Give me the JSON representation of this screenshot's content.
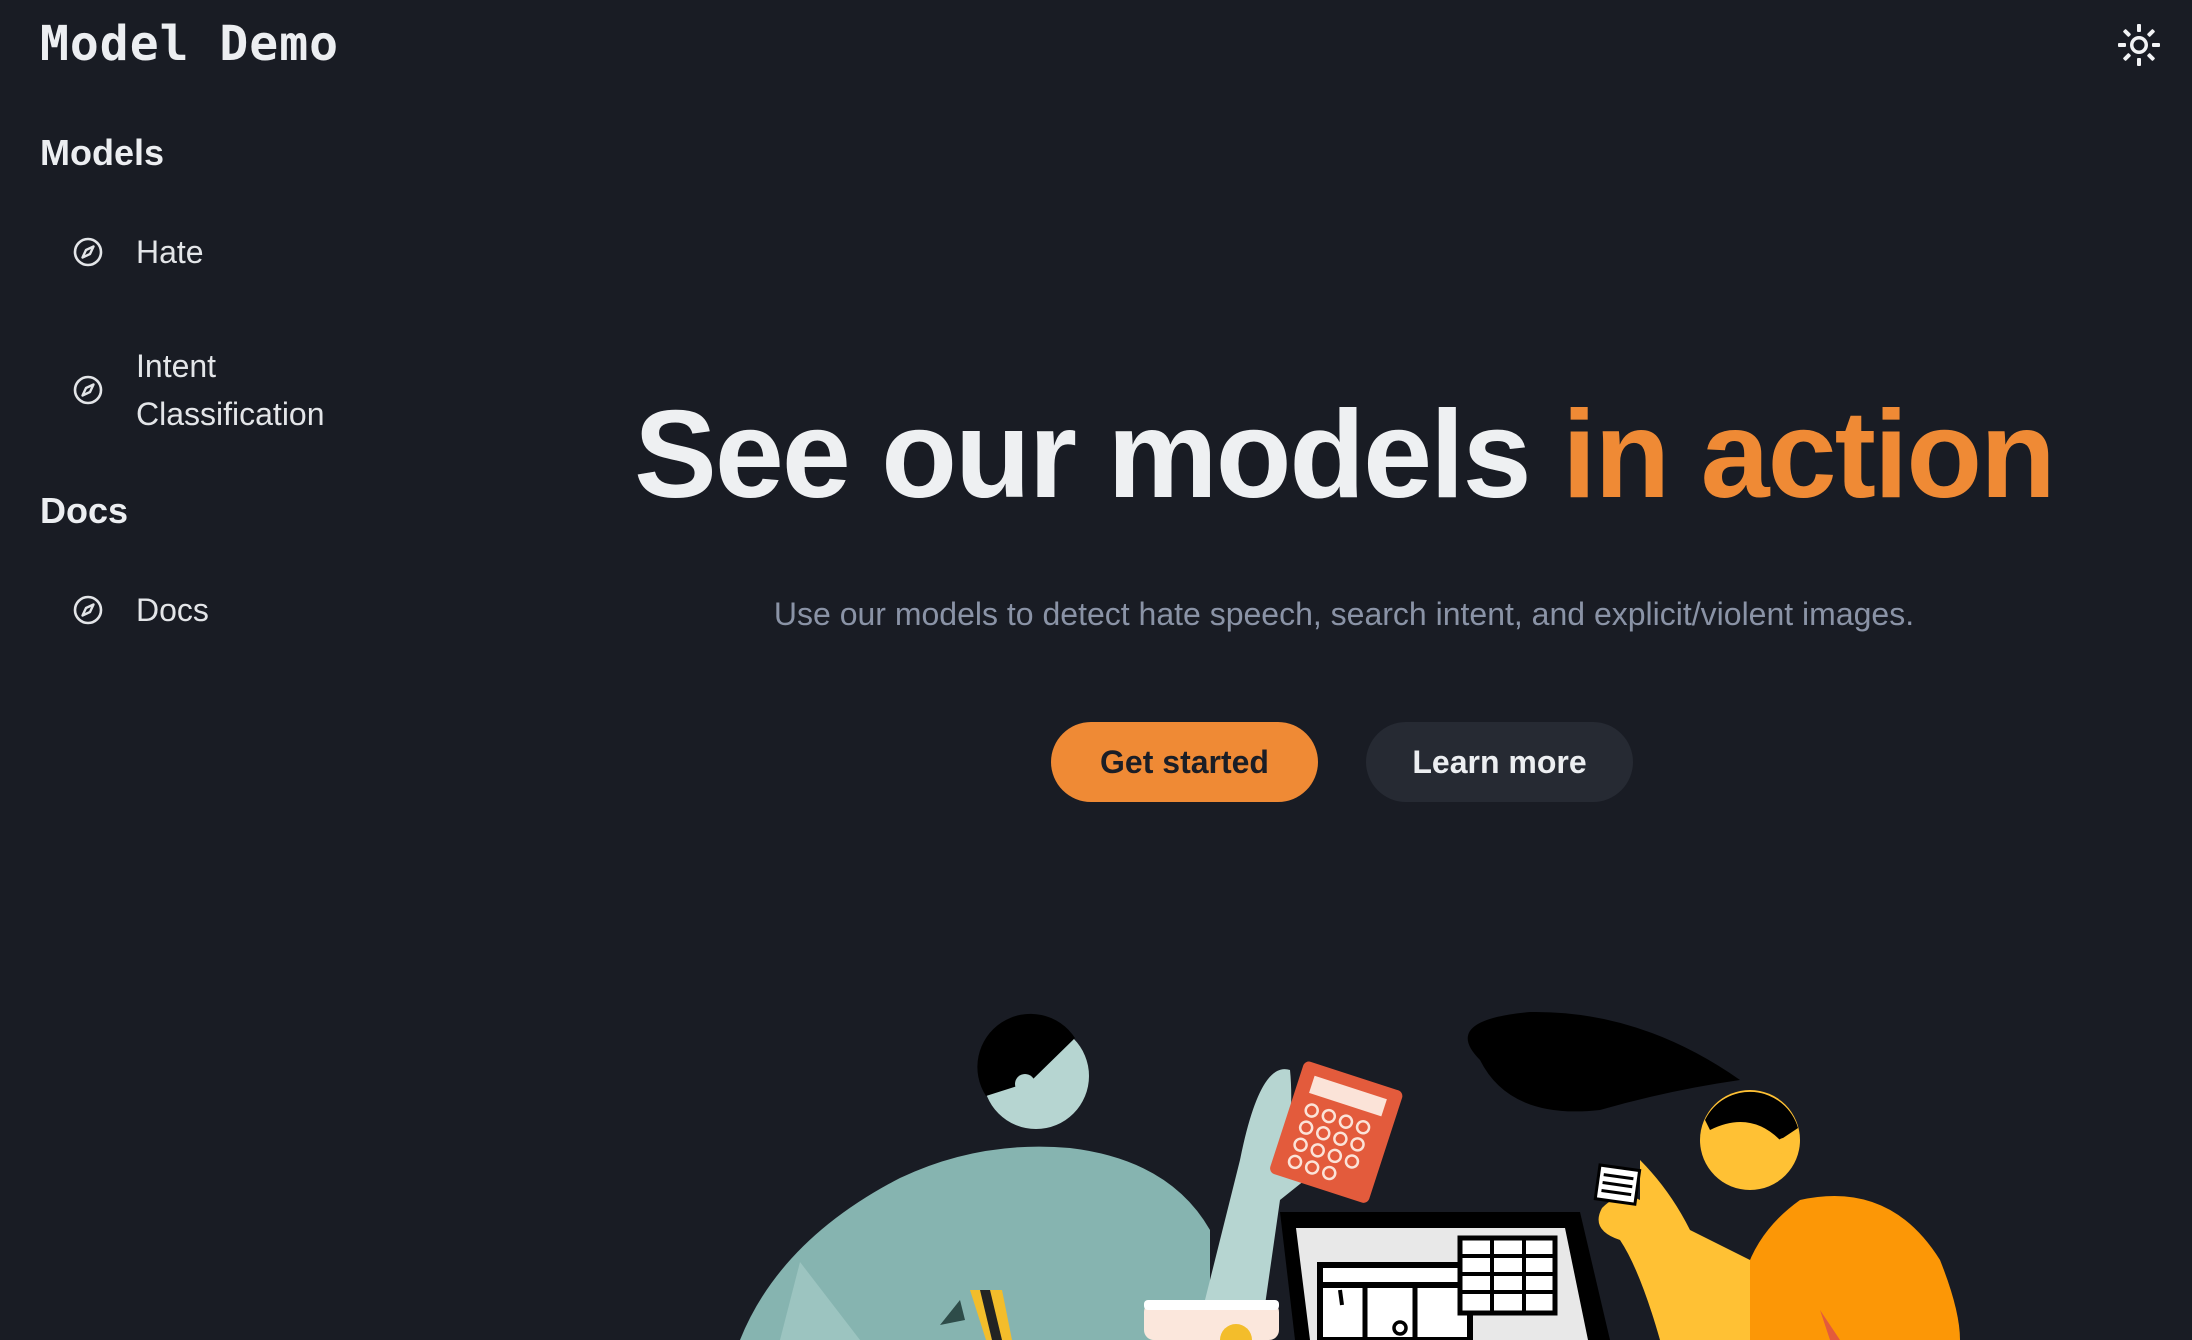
{
  "app": {
    "title": "Model Demo"
  },
  "header": {
    "theme_toggle_icon": "sun-icon"
  },
  "sidebar": {
    "sections": [
      {
        "heading": "Models",
        "items": [
          {
            "label": "Hate",
            "icon": "compass-icon"
          },
          {
            "label": "Intent Classification",
            "icon": "compass-icon"
          }
        ]
      },
      {
        "heading": "Docs",
        "items": [
          {
            "label": "Docs",
            "icon": "compass-icon"
          }
        ]
      }
    ]
  },
  "hero": {
    "title_main": "See our models",
    "title_accent": "in action",
    "subtitle": "Use our models to detect hate speech, search intent, and explicit/violent images.",
    "primary_button": "Get started",
    "secondary_button": "Learn more"
  },
  "colors": {
    "background": "#191c24",
    "accent": "#ef8a35",
    "secondary_button": "#262a33",
    "muted_text": "#8a93a6"
  }
}
